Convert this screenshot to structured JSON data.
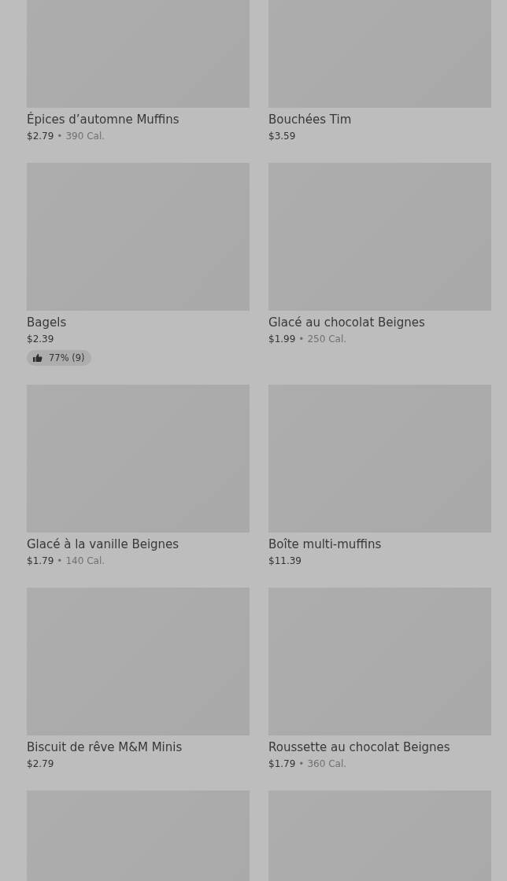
{
  "items": [
    {
      "name": "Épices d’automne Muffins",
      "price": "$2.79",
      "separator": "•",
      "calories": "390 Cal."
    },
    {
      "name": "Bouchées Tim",
      "price": "$3.59"
    },
    {
      "name": "Bagels",
      "price": "$2.39",
      "rating": "77% (9)"
    },
    {
      "name": "Glacé au chocolat Beignes",
      "price": "$1.99",
      "separator": "•",
      "calories": "250 Cal."
    },
    {
      "name": "Glacé à la vanille Beignes",
      "price": "$1.79",
      "separator": "•",
      "calories": "140 Cal."
    },
    {
      "name": "Boîte multi-muffins",
      "price": "$11.39"
    },
    {
      "name": "Biscuit de rêve M&M Minis",
      "price": "$2.79"
    },
    {
      "name": "Roussette au chocolat Beignes",
      "price": "$1.79",
      "separator": "•",
      "calories": "360 Cal."
    },
    {
      "kind": "image_only"
    },
    {
      "kind": "image_only"
    }
  ]
}
